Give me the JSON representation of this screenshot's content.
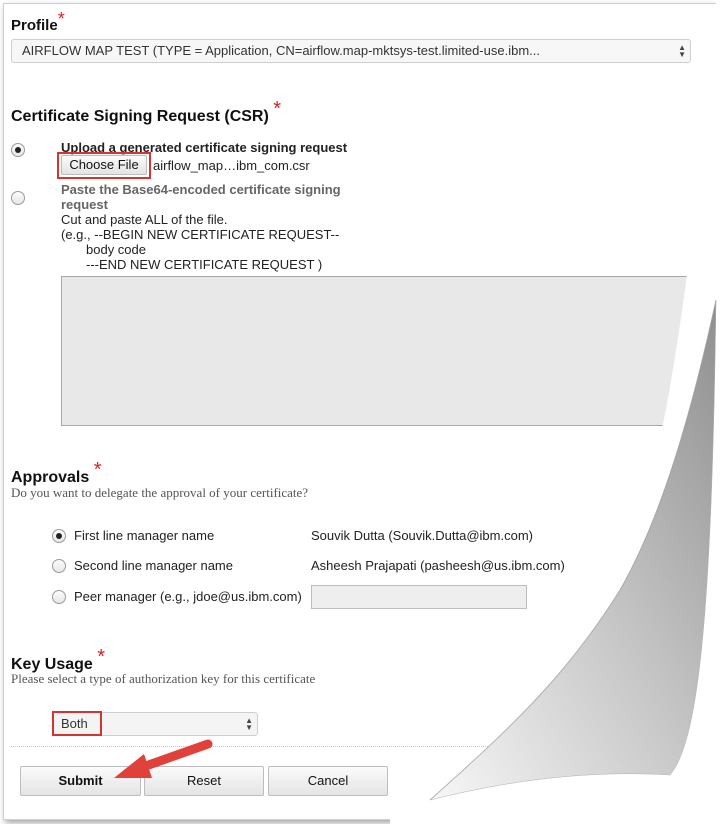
{
  "profile": {
    "label": "Profile",
    "required_mark": "*",
    "selected": "AIRFLOW MAP TEST (TYPE = Application, CN=airflow.map-mktsys-test.limited-use.ibm..."
  },
  "csr": {
    "heading": "Certificate Signing Request (CSR)",
    "required_mark": "*",
    "option_upload_label": "Upload a generated certificate signing request",
    "choose_file_label": "Choose File",
    "file_name": "airflow_map…ibm_com.csr",
    "option_paste_label_line1": "Paste the Base64-encoded certificate signing",
    "option_paste_label_line2": "request",
    "paste_hint_1": "Cut and paste ALL of the file.",
    "paste_hint_2": "(e.g., --BEGIN NEW CERTIFICATE REQUEST--",
    "paste_hint_3": "body code",
    "paste_hint_4": "---END NEW CERTIFICATE REQUEST )"
  },
  "approvals": {
    "heading": "Approvals",
    "required_mark": "*",
    "subtitle": "Do you want to delegate the approval of your certificate?",
    "options": [
      {
        "label": "First line manager name",
        "value": "Souvik Dutta (Souvik.Dutta@ibm.com)"
      },
      {
        "label": "Second line manager name",
        "value": "Asheesh Prajapati (pasheesh@us.ibm.com)"
      },
      {
        "label": "Peer manager (e.g., jdoe@us.ibm.com)",
        "value": ""
      }
    ]
  },
  "key_usage": {
    "heading": "Key Usage",
    "required_mark": "*",
    "subtitle": "Please select a type of authorization key for this certificate",
    "selected": "Both"
  },
  "buttons": {
    "submit": "Submit",
    "reset": "Reset",
    "cancel": "Cancel"
  },
  "colors": {
    "highlight": "#d83232",
    "arrow": "#e0413a",
    "page_curl": "#c9c9c9"
  }
}
